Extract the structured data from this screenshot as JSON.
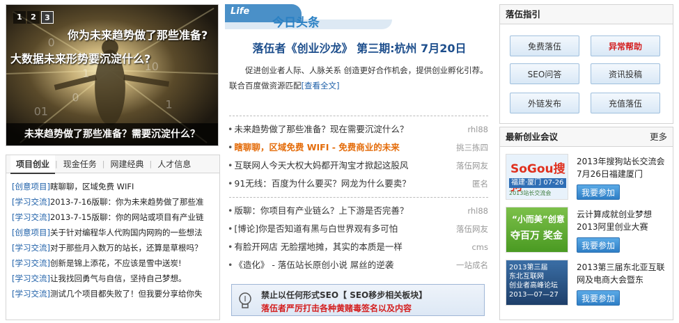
{
  "slider": {
    "nums": [
      "1",
      "2",
      "3"
    ],
    "active": 2,
    "line1": "你为未来趋势做了那些准备?",
    "line2": "大数据未来形势要沉淀什么?",
    "caption": "未来趋势做了那些准备？需要沉淀什么？"
  },
  "project": {
    "tabs": [
      "项目创业",
      "现金任务",
      "网建经典",
      "人才信息"
    ],
    "items": [
      {
        "tag": "[创意项目]",
        "text": "瞎聊聊，区域免费 WIFI"
      },
      {
        "tag": "[学习交流]",
        "text": "2013-7-16版聊：你为未来趋势做了那些准"
      },
      {
        "tag": "[学习交流]",
        "text": "2013-7-15版聊：你的网站或项目有产业链"
      },
      {
        "tag": "[创意项目]",
        "text": "关于针对编程华人代购国内网购的一些想法"
      },
      {
        "tag": "[学习交流]",
        "text": "对于那些月入数万的站长，还算是草根吗？"
      },
      {
        "tag": "[学习交流]",
        "text": "创新是锦上添花，不应该是雪中送炭!"
      },
      {
        "tag": "[学习交流]",
        "text": "让我找回勇气与自信，坚持自己梦想。"
      },
      {
        "tag": "[学习交流]",
        "text": "测试几个项目都失败了！但我要分享给你失"
      }
    ]
  },
  "today": {
    "badge": "Life",
    "title": "今日头条",
    "headline": "落伍者《创业沙龙》 第三期:杭州 7月20日",
    "summary": "促进创业者人际、人脉关系 创造更好合作机会，提供创业孵化引荐。联合百度做资源匹配",
    "summary_more": "[查看全文]"
  },
  "news1": [
    {
      "text": "未来趋势做了那些准备？现在需要沉淀什么？",
      "src": "rhl88",
      "hot": false
    },
    {
      "text": "瞎聊聊，区域免费 WIFI - 免费商业的未来",
      "src": "挑三拣四",
      "hot": true
    },
    {
      "text": "互联网人今天大权大妈都开淘宝才掀起这股风",
      "src": "落伍网友",
      "hot": false
    },
    {
      "text": "91无线：百度为什么要买？网龙为什么要卖？",
      "src": "匿名",
      "hot": false
    }
  ],
  "news2": [
    {
      "text": "版聊：你项目有产业链么？上下游是否完善？",
      "src": "rhl88",
      "hot": false
    },
    {
      "text": "[博论]你是否知道有黑与白世界观有多可怕",
      "src": "落伍网友",
      "hot": false
    },
    {
      "text": "有脸开网店 无脸摆地摊，其实的本质是一样",
      "src": "cms",
      "hot": false
    },
    {
      "text": "《造化》 - 落伍站长原创小说 屌丝的逆袭",
      "src": "一站成名",
      "hot": false
    }
  ],
  "notice": {
    "line1": "禁止以任何形式SEO【 SEO移步相关板块】",
    "line2": "落伍者严厉打击各种黄赌毒签名以及内容"
  },
  "guide": {
    "title": "落伍指引",
    "buttons": [
      {
        "label": "免费落伍",
        "red": false
      },
      {
        "label": "异常帮助",
        "red": true
      },
      {
        "label": "SEO问答",
        "red": false
      },
      {
        "label": "资讯投稿",
        "red": false
      },
      {
        "label": "外链发布",
        "red": false
      },
      {
        "label": "充值落伍",
        "red": false
      }
    ]
  },
  "conference": {
    "title": "最新创业会议",
    "more": "更多",
    "join_label": "我要参加",
    "items": [
      {
        "text": "2013年搜狗站长交流会7月26日福建厦门",
        "img_l1": "SoGou搜狗",
        "img_l2": "福建·厦门 07-26",
        "img_l3": "2013站长交流会"
      },
      {
        "text": "云计算成就创业梦想2013阿里创业大赛",
        "img_l1": "“小而美”创意",
        "img_l2": "夺百万 奖金"
      },
      {
        "text": "2013第三届东北亚互联网及电商大会暨东",
        "img_l1": "2013第三届\n东北互联网\n创业者高峰论坛\n2013—07—27"
      }
    ]
  },
  "colors": {
    "accent_blue": "#2b81c4",
    "hot_orange": "#e46c0a",
    "alert_red": "#d41e1e",
    "link_blue": "#1d5fa8"
  }
}
